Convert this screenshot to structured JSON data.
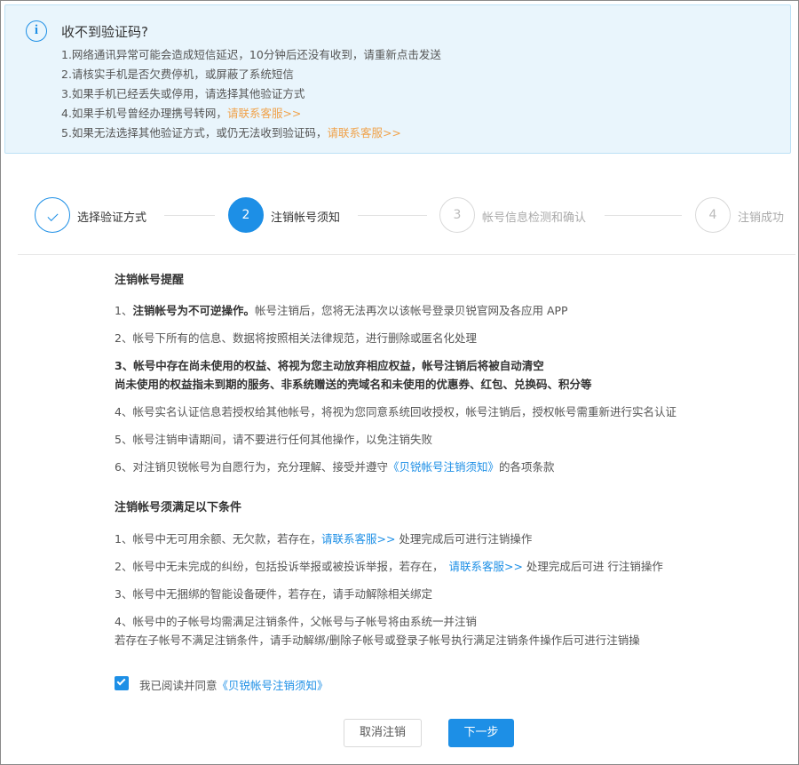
{
  "notice": {
    "title": "收不到验证码?",
    "lines": [
      {
        "text": "1.网络通讯异常可能会造成短信延迟，10分钟后还没有收到，请重新点击发送",
        "link": ""
      },
      {
        "text": "2.请核实手机是否欠费停机，或屏蔽了系统短信",
        "link": ""
      },
      {
        "text": "3.如果手机已经丢失或停用，请选择其他验证方式",
        "link": ""
      },
      {
        "text": "4.如果手机号曾经办理携号转网，",
        "link": "请联系客服>>"
      },
      {
        "text": "5.如果无法选择其他验证方式，或仍无法收到验证码，",
        "link": "请联系客服>>"
      }
    ]
  },
  "steps": [
    {
      "number": "",
      "label": "选择验证方式",
      "state": "done"
    },
    {
      "number": "2",
      "label": "注销帐号须知",
      "state": "active"
    },
    {
      "number": "3",
      "label": "帐号信息检测和确认",
      "state": "todo"
    },
    {
      "number": "4",
      "label": "注销成功",
      "state": "todo"
    }
  ],
  "reminder": {
    "title": "注销帐号提醒",
    "item1_prefix": "1、",
    "item1_bold": "注销帐号为不可逆操作。",
    "item1_rest": "帐号注销后，您将无法再次以该帐号登录贝锐官网及各应用 APP",
    "item2": "2、帐号下所有的信息、数据将按照相关法律规范，进行删除或匿名化处理",
    "item3_line1": "3、帐号中存在尚未使用的权益、将视为您主动放弃相应权益，帐号注销后将被自动清空",
    "item3_line2": "尚未使用的权益指未到期的服务、非系统赠送的壳域名和未使用的优惠券、红包、兑换码、积分等",
    "item4": "4、帐号实名认证信息若授权给其他帐号，将视为您同意系统回收授权，帐号注销后，授权帐号需重新进行实名认证",
    "item5": "5、帐号注销申请期间，请不要进行任何其他操作，以免注销失败",
    "item6_prefix": "6、对注销贝锐帐号为自愿行为，充分理解、接受并遵守",
    "item6_link": "《贝锐帐号注销须知》",
    "item6_suffix": "的各项条款"
  },
  "conditions": {
    "title": "注销帐号须满足以下条件",
    "item1_prefix": "1、帐号中无可用余额、无欠款，若存在，",
    "item1_link": "请联系客服>>",
    "item1_suffix": " 处理完成后可进行注销操作",
    "item2_prefix": "2、帐号中无未完成的纠纷，包括投诉举报或被投诉举报，若存在，",
    "item2_link": "请联系客服>>",
    "item2_suffix": " 处理完成后可进 行注销操作",
    "item3": "3、帐号中无捆绑的智能设备硬件，若存在，请手动解除相关绑定",
    "item4_line1": "4、帐号中的子帐号均需满足注销条件，父帐号与子帐号将由系统一并注销",
    "item4_line2": "若存在子帐号不满足注销条件，请手动解绑/删除子帐号或登录子帐号执行满足注销条件操作后可进行注销操"
  },
  "agree": {
    "checked": true,
    "text": "我已阅读并同意",
    "link": "《贝锐帐号注销须知》"
  },
  "buttons": {
    "cancel": "取消注销",
    "next": "下一步"
  },
  "colors": {
    "primary": "#1d8fe6",
    "notice_bg": "#e9f5fc",
    "orange_link": "#f0a24a"
  },
  "icons": {
    "notice": "info-circle-icon",
    "step_done": "check-icon",
    "checkbox": "checkbox-checked-icon"
  }
}
